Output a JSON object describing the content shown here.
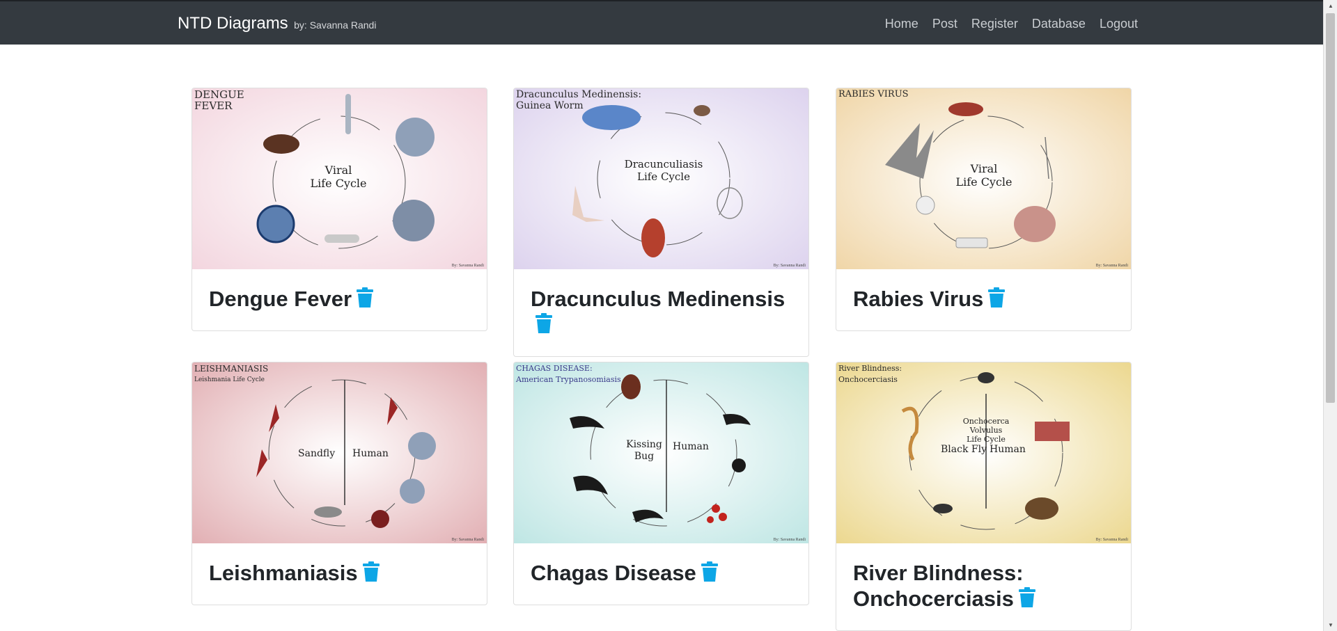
{
  "navbar": {
    "brand": "NTD Diagrams",
    "byline": "by: Savanna Randi",
    "links": [
      "Home",
      "Post",
      "Register",
      "Database",
      "Logout"
    ]
  },
  "cards": [
    {
      "title": "Dengue Fever",
      "image": {
        "corner": [
          "DENGUE",
          "FEVER"
        ],
        "center": [
          "Viral",
          "Life Cycle"
        ],
        "signature": "By: Savanna Randi",
        "tint": "#f3d6df"
      }
    },
    {
      "title": "Dracunculus Medinensis",
      "image": {
        "corner": [
          "Dracunculus Medinensis:",
          "Guinea Worm"
        ],
        "center": [
          "Dracunculiasis",
          "Life Cycle"
        ],
        "signature": "By: Savanna Randi",
        "tint": "#ddd3ee"
      }
    },
    {
      "title": "Rabies Virus",
      "image": {
        "corner": [
          "RABIES VIRUS"
        ],
        "center": [
          "Viral",
          "Life Cycle"
        ],
        "signature": "By: Savanna Randi",
        "tint": "#f0d6a8"
      }
    },
    {
      "title": "Leishmaniasis",
      "image": {
        "corner": [
          "LEISHMANIASIS",
          "Leishmania Life Cycle"
        ],
        "left_label": "Sandfly",
        "right_label": "Human",
        "signature": "By: Savanna Randi",
        "tint": "#e2b0b4"
      }
    },
    {
      "title": "Chagas Disease",
      "image": {
        "corner": [
          "CHAGAS DISEASE:",
          "American Trypanosomiasis"
        ],
        "left_label": "Kissing Bug",
        "right_label": "Human",
        "signature": "By: Savanna Randi",
        "tint": "#bfe6e4"
      }
    },
    {
      "title": "River Blindness: Onchocerciasis",
      "image": {
        "corner": [
          "River Blindness:",
          "Onchocerciasis"
        ],
        "center": [
          "Onchocerca Volvulus",
          "Life Cycle"
        ],
        "left_label": "Black Fly",
        "right_label": "Human",
        "signature": "By: Savanna Randi",
        "tint": "#ecd890"
      }
    }
  ],
  "icons": {
    "delete": "trash-icon"
  },
  "colors": {
    "navbar": "#343a40",
    "trash": "#0da6e6",
    "link": "#c9cdd1"
  }
}
